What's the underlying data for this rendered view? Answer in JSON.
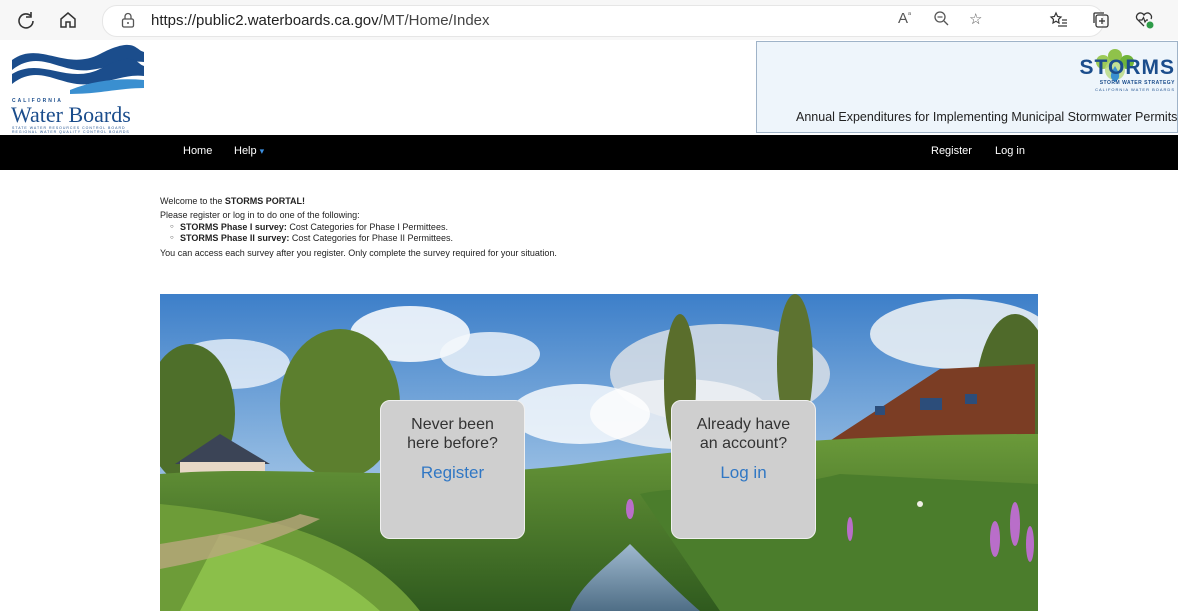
{
  "browser": {
    "url_host": "https://public2.waterboards.ca.gov",
    "url_path": "/MT/Home/Index",
    "icons": [
      "refresh-icon",
      "home-icon",
      "lock-icon",
      "read-aloud-icon",
      "zoom-icon",
      "favorite-star-icon",
      "favorites-icon",
      "collections-icon",
      "health-icon"
    ]
  },
  "header": {
    "logo": {
      "state": "CALIFORNIA",
      "name": "Water Boards",
      "line1": "STATE WATER RESOURCES CONTROL BOARD",
      "line2": "REGIONAL WATER QUALITY CONTROL BOARDS"
    },
    "storms_logo": {
      "word": "STORMS",
      "tagline": "STORM WATER STRATEGY",
      "tagline2": "CALIFORNIA WATER BOARDS"
    },
    "title": "Annual Expenditures for Implementing Municipal Stormwater Permits"
  },
  "nav": {
    "home": "Home",
    "help": "Help",
    "register": "Register",
    "login": "Log in"
  },
  "content": {
    "welcome_prefix": "Welcome to the ",
    "welcome_bold": "STORMS PORTAL!",
    "instruction": "Please register or log in to do one of the following:",
    "items": [
      {
        "bold": "STORMS Phase I survey:",
        "text": " Cost Categories for Phase I Permittees."
      },
      {
        "bold": "STORMS Phase II survey:",
        "text": " Cost Categories for Phase II Permittees."
      }
    ],
    "note": "You can access each survey after you register. Only complete the survey required for your situation."
  },
  "cards": {
    "register": {
      "line1": "Never been",
      "line2": "here before?",
      "link": "Register"
    },
    "login": {
      "line1": "Already have",
      "line2": "an account?",
      "link": "Log in"
    }
  },
  "colors": {
    "nav_bg": "#000000",
    "link": "#3077c4",
    "brand": "#1b4d8c"
  }
}
